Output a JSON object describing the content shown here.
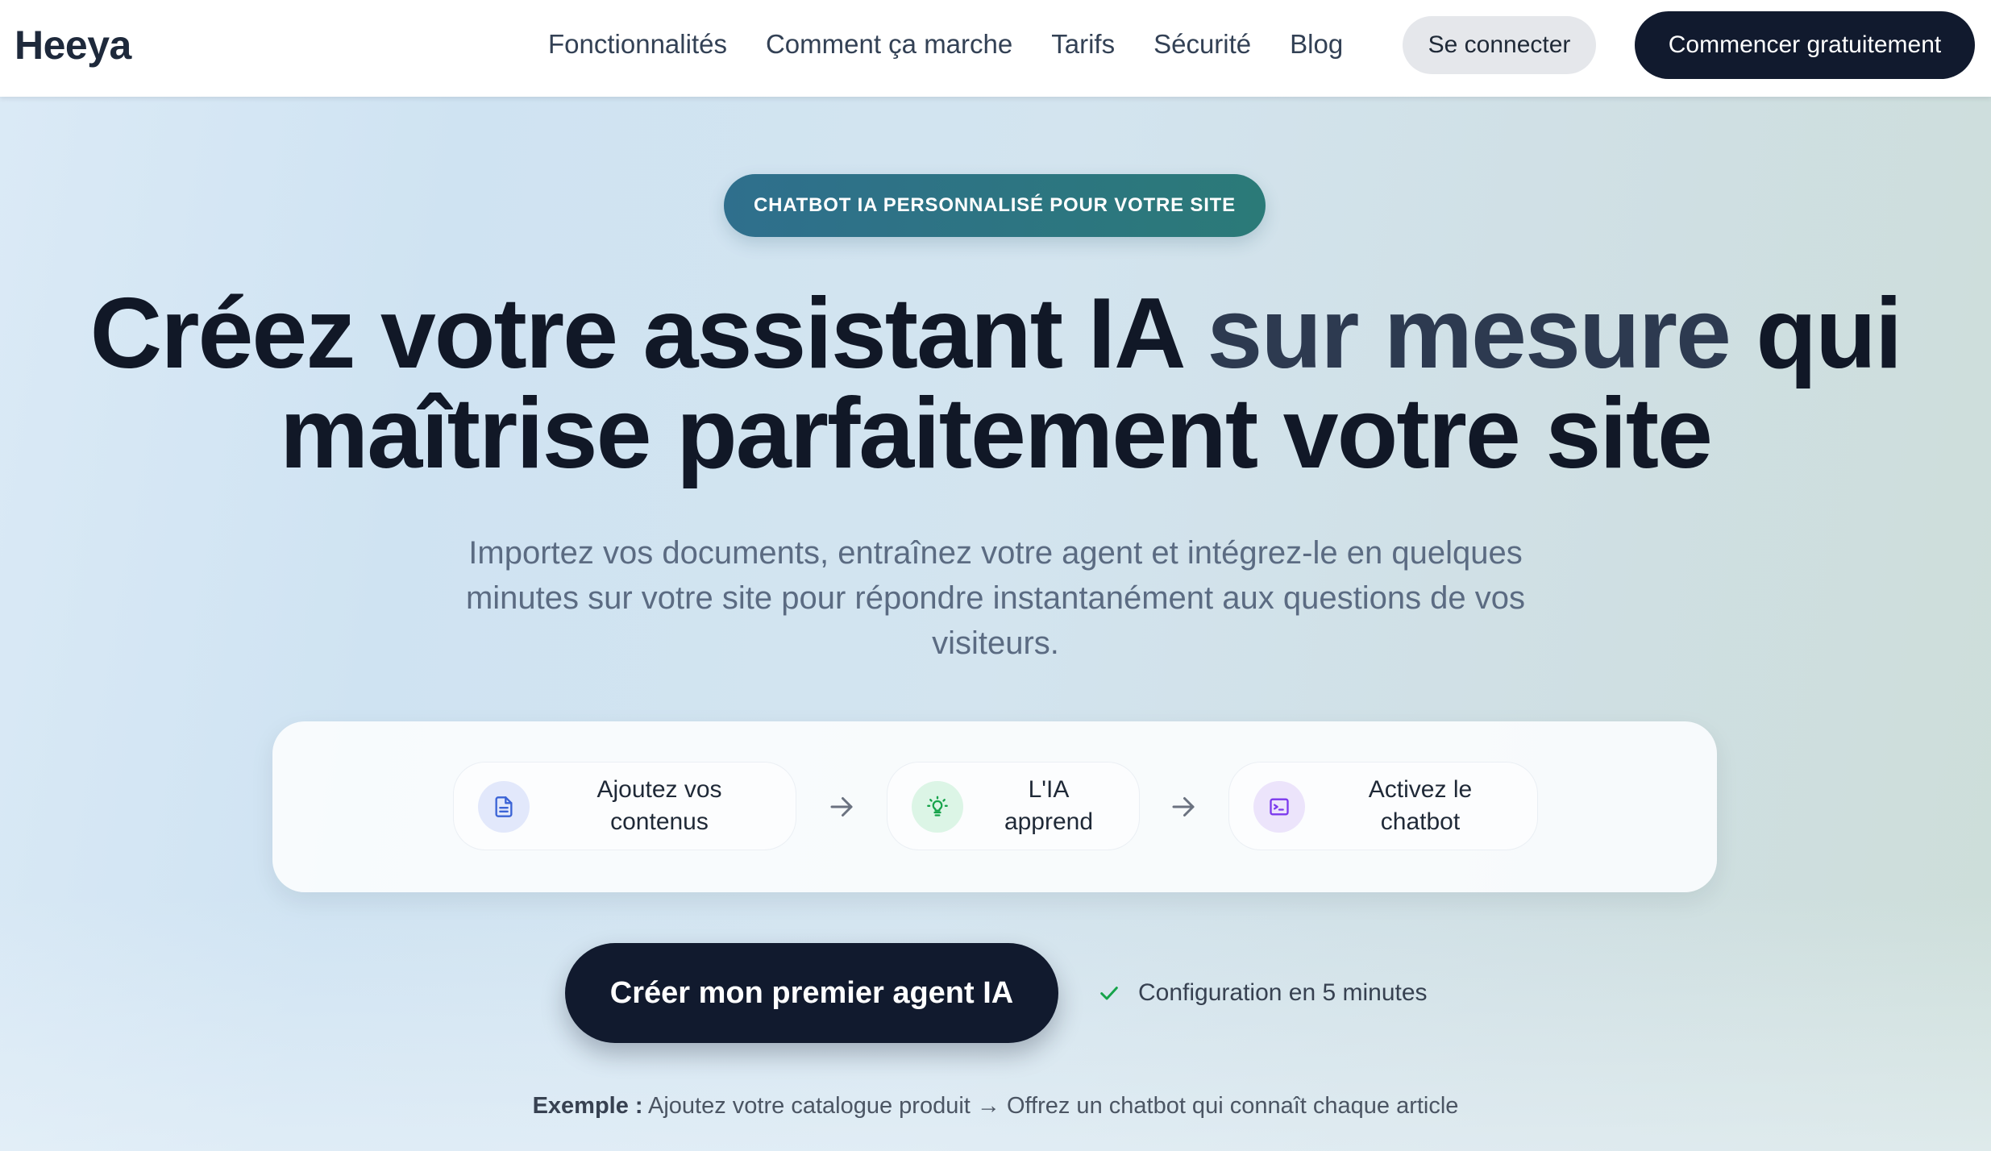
{
  "header": {
    "logo": "Heeya",
    "nav": [
      {
        "label": "Fonctionnalités"
      },
      {
        "label": "Comment ça marche"
      },
      {
        "label": "Tarifs"
      },
      {
        "label": "Sécurité"
      },
      {
        "label": "Blog"
      }
    ],
    "login_label": "Se connecter",
    "start_label": "Commencer gratuitement"
  },
  "hero": {
    "badge": "CHATBOT IA PERSONNALISÉ POUR VOTRE SITE",
    "headline": {
      "line1_a": "Créez votre assistant IA ",
      "line1_accent": "sur mesure",
      "line1_b": " qui",
      "line2": "maîtrise parfaitement votre site"
    },
    "subtitle": "Importez vos documents, entraînez votre agent et intégrez-le en quelques minutes sur votre site pour répondre instantanément aux questions de vos visiteurs.",
    "steps": [
      {
        "label_1": "Ajoutez vos",
        "label_2": "contenus",
        "icon": "document-icon",
        "icon_color": "#3b63d6",
        "icon_bg": "#e2e8fb"
      },
      {
        "label_1": "L'IA",
        "label_2": "apprend",
        "icon": "lightbulb-icon",
        "icon_color": "#16a34a",
        "icon_bg": "#dcf5e6"
      },
      {
        "label_1": "Activez le",
        "label_2": "chatbot",
        "icon": "terminal-icon",
        "icon_color": "#7c3aed",
        "icon_bg": "#ece4fb"
      }
    ],
    "cta_label": "Créer mon premier agent IA",
    "config_note": "Configuration en 5 minutes",
    "example_prefix": "Exemple :",
    "example_text": " Ajoutez votre catalogue produit → Offrez un chatbot qui connaît chaque article"
  },
  "colors": {
    "primary_dark": "#111a2e",
    "badge_start": "#2f6f8d",
    "badge_end": "#2b7a78",
    "check": "#16a34a"
  }
}
